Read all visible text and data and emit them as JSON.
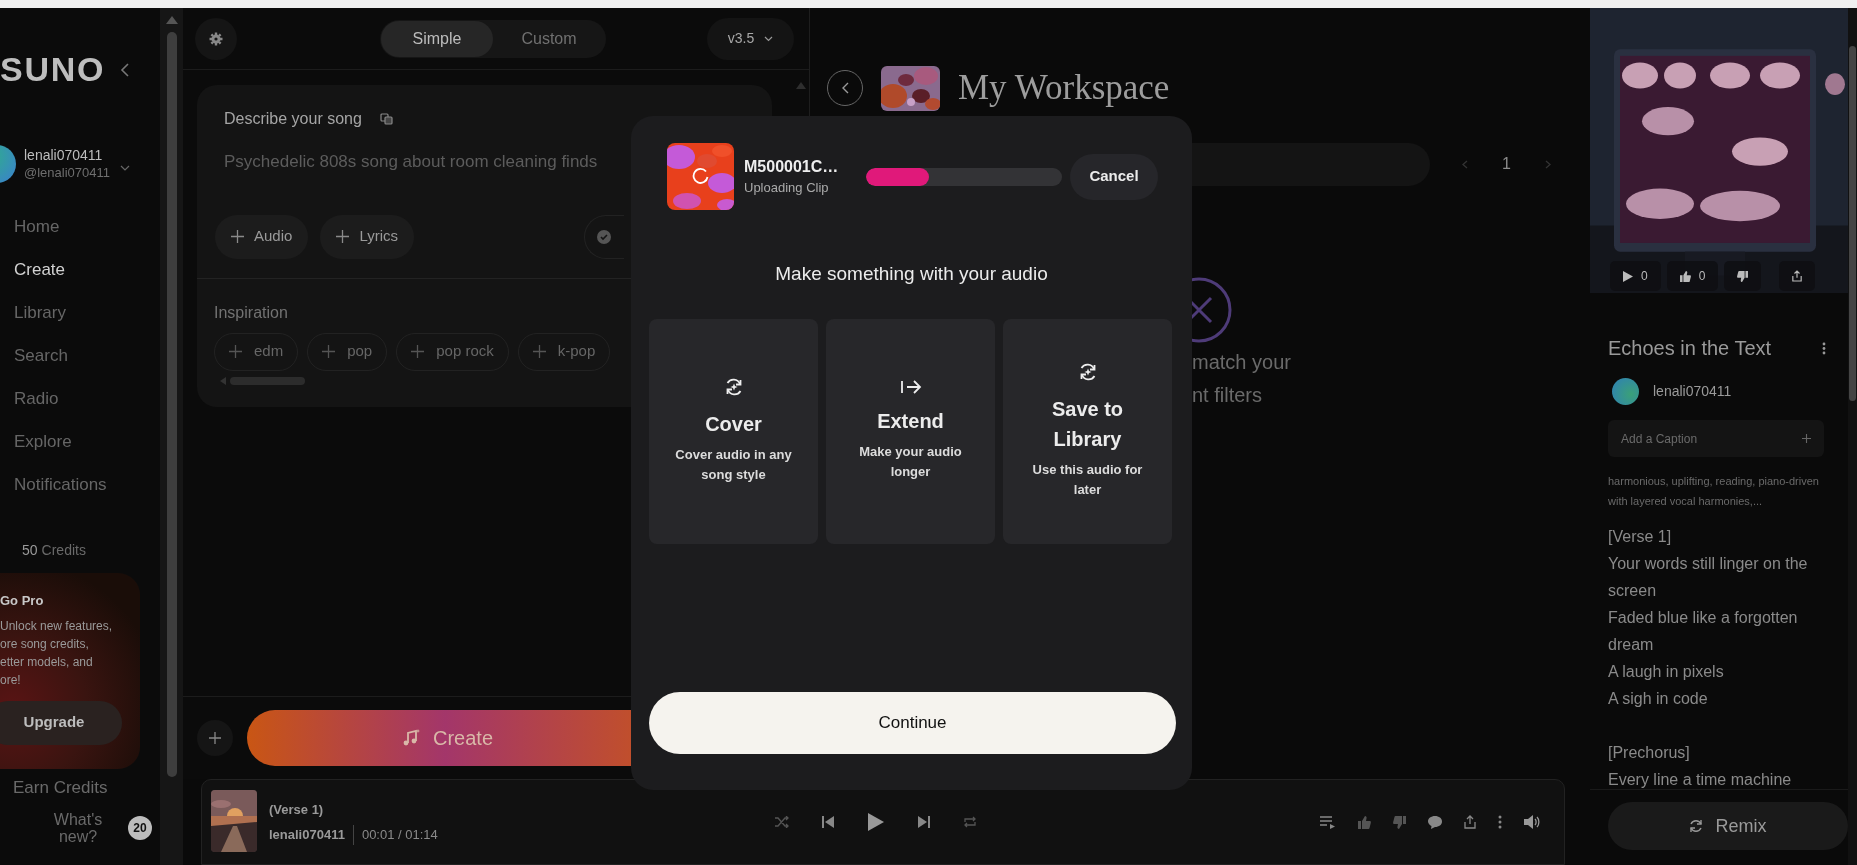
{
  "sidebar": {
    "logo": "SUNO",
    "user": {
      "name": "lenali070411",
      "handle": "@lenali070411"
    },
    "nav": [
      {
        "label": "Home",
        "selected": false
      },
      {
        "label": "Create",
        "selected": true
      },
      {
        "label": "Library",
        "selected": false
      },
      {
        "label": "Search",
        "selected": false
      },
      {
        "label": "Radio",
        "selected": false
      },
      {
        "label": "Explore",
        "selected": false
      },
      {
        "label": "Notifications",
        "selected": false
      }
    ],
    "credits": {
      "count": "50",
      "label": "Credits"
    },
    "promo": {
      "title": "Go Pro",
      "lines": [
        "Unlock new features,",
        "ore song credits,",
        "etter models, and",
        "ore!"
      ],
      "button": "Upgrade"
    },
    "earn_credits": "Earn Credits",
    "whats_new": {
      "label": "What's new?",
      "badge": "20"
    }
  },
  "create": {
    "modes": [
      {
        "label": "Simple",
        "selected": true
      },
      {
        "label": "Custom",
        "selected": false
      }
    ],
    "model": "v3.5",
    "prompt": {
      "label": "Describe your song",
      "placeholder": "Psychedelic 808s song about room cleaning finds"
    },
    "add_buttons": [
      "Audio",
      "Lyrics"
    ],
    "inspiration": {
      "label": "Inspiration",
      "tags": [
        "edm",
        "pop",
        "pop rock",
        "k-pop"
      ]
    },
    "create_button": "Create"
  },
  "workspace": {
    "title": "My Workspace",
    "page": "1",
    "empty_text": [
      "match your",
      "nt filters"
    ]
  },
  "song_panel": {
    "stats": [
      {
        "kind": "plays",
        "count": "0"
      },
      {
        "kind": "likes",
        "count": "0"
      },
      {
        "kind": "dislike"
      },
      {
        "kind": "share"
      }
    ],
    "title": "Echoes in the Text",
    "user": "lenali070411",
    "caption": {
      "placeholder": "Add a Caption"
    },
    "tags": "harmonious, uplifting, reading, piano-driven with layered vocal harmonies,...",
    "lyrics": [
      {
        "lines": [
          "[Verse 1]",
          "Your words still linger on the screen",
          "Faded blue like a forgotten dream",
          "A laugh in pixels",
          "A sigh in code"
        ]
      },
      {
        "lines": [
          "[Prechorus]",
          "Every line a time machine"
        ]
      }
    ],
    "remix": "Remix"
  },
  "player": {
    "title": "(Verse 1)",
    "artist": "lenali070411",
    "time": "00:01 / 01:14"
  },
  "modal": {
    "file": {
      "name": "M500001C…",
      "status": "Uploading Clip"
    },
    "progress": {
      "level": 0.32
    },
    "cancel": "Cancel",
    "heading": "Make something with your audio",
    "options": [
      {
        "kind": "cover",
        "title": "Cover",
        "text": "Cover audio in any song style"
      },
      {
        "kind": "extend",
        "title": "Extend",
        "text": "Make your audio longer"
      },
      {
        "kind": "save",
        "title": "Save to Library",
        "text": "Use this audio for later"
      }
    ],
    "continue": "Continue"
  }
}
